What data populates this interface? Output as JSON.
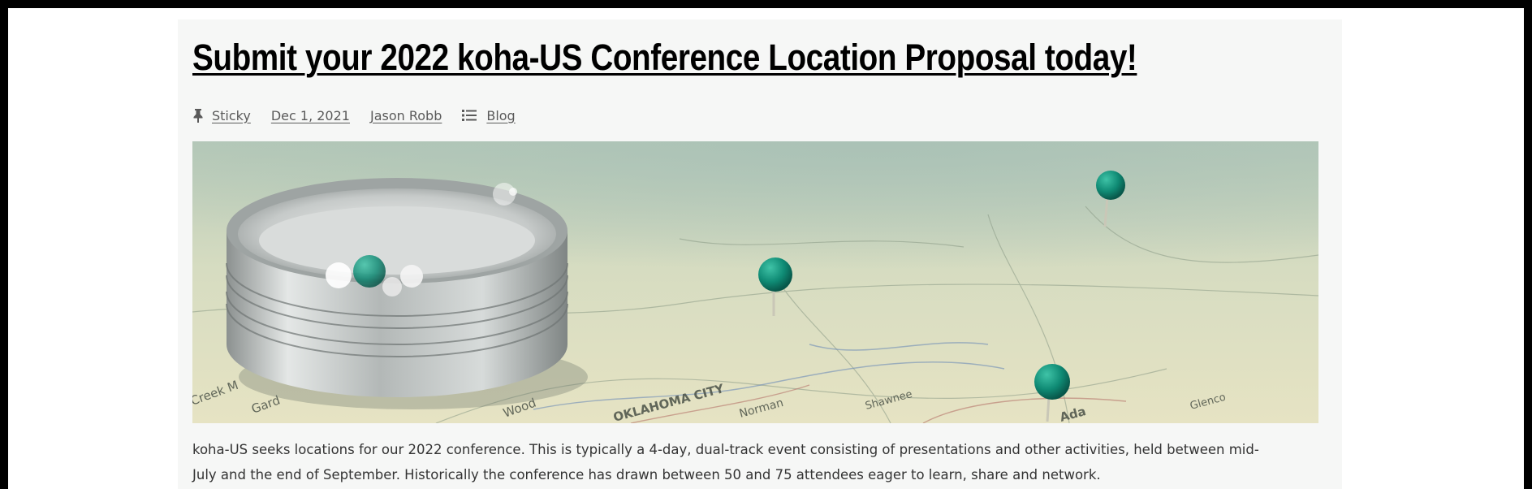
{
  "post": {
    "title": "Submit your 2022 koha-US Conference Location Proposal today!",
    "meta": {
      "sticky_label": "Sticky",
      "date": "Dec 1, 2021",
      "author": "Jason Robb",
      "category": "Blog"
    },
    "icons": {
      "sticky": "pushpin-icon",
      "category": "list-icon"
    },
    "body_lines": [
      "koha-US seeks locations for our 2022 conference. This is typically a 4-day, dual-track event consisting of presentations and other activities, held between mid-",
      "July and the end of September. Historically the conference has drawn between 50 and 75 attendees eager to learn, share and network."
    ]
  },
  "image_map_labels": [
    "Gard",
    "Creek M",
    "Wood",
    "Norman",
    "OKLAHOMA CITY",
    "Shawnee",
    "Ada",
    "Glenco"
  ],
  "colors": {
    "page_background": "#ffffff",
    "card_background": "#f6f7f6",
    "title": "#000000",
    "meta_text": "#5a5a5a",
    "body_text": "#333333",
    "pin": "#0f8a74"
  }
}
